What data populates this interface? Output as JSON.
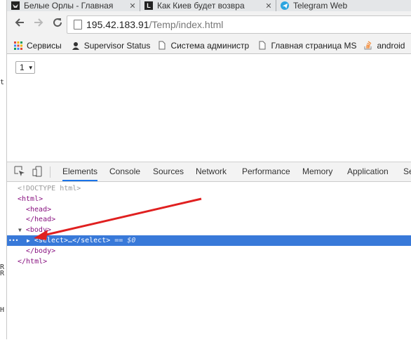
{
  "tabs": [
    {
      "title": "Белые Орлы - Главная",
      "favicon": "eagle-icon"
    },
    {
      "title": "Как Киев будет возвра",
      "favicon": "letter-l-icon"
    },
    {
      "title": "Telegram Web",
      "favicon": "telegram-icon"
    }
  ],
  "address": {
    "host": "195.42.183.91",
    "path": "/Temp/index.html"
  },
  "bookmarks": [
    {
      "label": "Сервисы",
      "icon": "apps-grid-icon"
    },
    {
      "label": "Supervisor Status",
      "icon": "supervisor-icon"
    },
    {
      "label": "Система администр",
      "icon": "page-icon"
    },
    {
      "label": "Главная страница MS",
      "icon": "page-icon"
    },
    {
      "label": "android",
      "icon": "stackoverflow-icon"
    }
  ],
  "page": {
    "select_value": "1"
  },
  "devtools": {
    "tabs": [
      "Elements",
      "Console",
      "Sources",
      "Network",
      "Performance",
      "Memory",
      "Application",
      "Se"
    ],
    "active_tab": "Elements",
    "dom": {
      "doctype": "<!DOCTYPE html>",
      "html_open": "<html>",
      "head_open": "<head>",
      "head_close": "</head>",
      "body_open": "<body>",
      "select_open": "<select>",
      "ellipsis": "…",
      "select_close": "</select>",
      "selected_ref": "== $0",
      "body_close": "</body>",
      "html_close": "</html>",
      "gutter_dots": "•••"
    }
  },
  "left_strip": {
    "chars": [
      "t",
      "R",
      "R",
      "H"
    ]
  },
  "colors": {
    "selection": "#3879d9",
    "tag": "#881280",
    "arrow": "#e02020",
    "telegram": "#2ca5e0"
  }
}
